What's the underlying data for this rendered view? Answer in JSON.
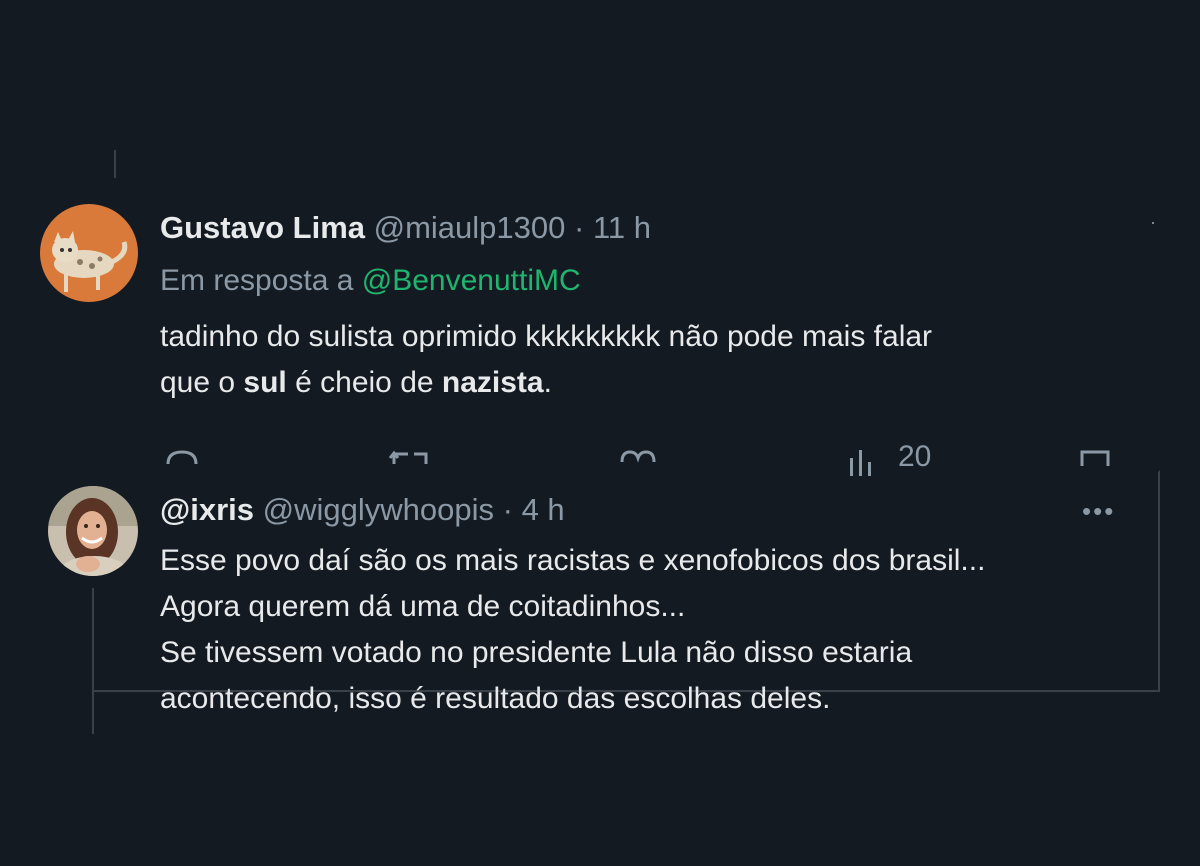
{
  "tweet1": {
    "name": "Gustavo Lima",
    "handle": "@miaulp1300",
    "separator": "·",
    "time": "11 h",
    "reply_prefix": "Em resposta a",
    "reply_mention": "@BenvenuttiMC",
    "text_line1": "tadinho do sulista oprimido kkkkkkkkk não pode mais falar",
    "text_line2_a": "que o ",
    "text_line2_b": "sul",
    "text_line2_c": " é cheio de ",
    "text_line2_d": "nazista",
    "text_line2_e": ".",
    "actions": {
      "views_count": "20"
    }
  },
  "tweet2": {
    "name": "@ixris",
    "handle": "@wigglywhoopis",
    "separator": "·",
    "time": "4 h",
    "more_label": "•••",
    "lines": [
      "Esse povo daí são os mais racistas e xenofobicos dos brasil...",
      "Agora querem dá uma de coitadinhos...",
      "Se tivessem votado no presidente Lula não disso estaria",
      "acontecendo, isso é resultado das escolhas deles."
    ]
  },
  "colors": {
    "background": "#141a22",
    "text": "#e7e9ea",
    "secondary": "#8b98a5",
    "mention": "#1fb56f"
  }
}
